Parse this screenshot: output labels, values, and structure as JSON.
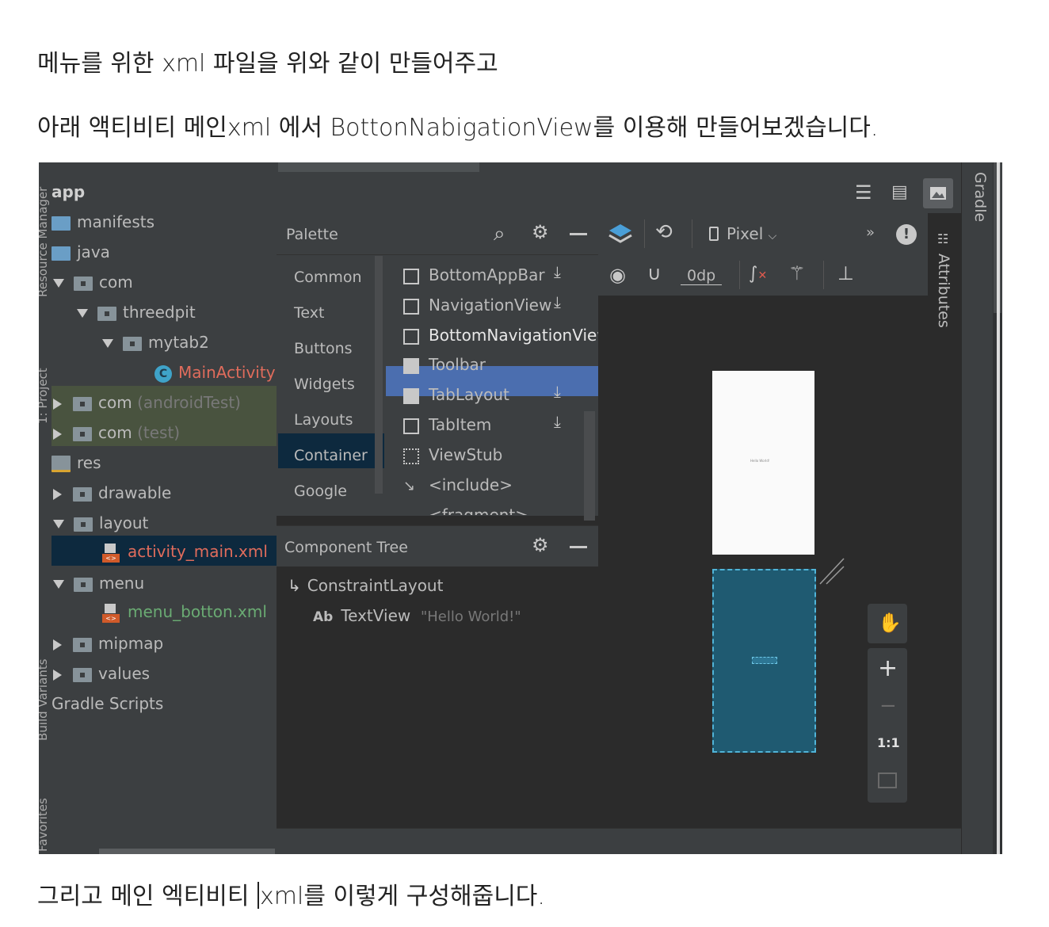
{
  "paragraphs": {
    "p1": "메뉴를 위한 xml 파일을 위와 같이 만들어주고",
    "p2": "아래 액티비티 메인xml 에서 BottonNabigationView를 이용해 만들어보겠습니다.",
    "p3_before": "그리고 메인 엑티비티 ",
    "p3_after": "xml를  이렇게 구성해줍니다."
  },
  "side_strips": {
    "resource_manager": "Resource Manager",
    "project": "1: Project",
    "build_variants": "Build Variants",
    "favorites": "Favorites",
    "gradle": "Gradle",
    "attributes": "Attributes"
  },
  "project_tree": {
    "app": "app",
    "manifests": "manifests",
    "java": "java",
    "com": "com",
    "threedpit": "threedpit",
    "mytab2": "mytab2",
    "main_activity": "MainActivity",
    "com_android_test": "com",
    "android_test_suffix": "(androidTest)",
    "com_test": "com",
    "test_suffix": "(test)",
    "res": "res",
    "drawable": "drawable",
    "layout": "layout",
    "activity_main": "activity_main.xml",
    "menu": "menu",
    "menu_botton": "menu_botton.xml",
    "mipmap": "mipmap",
    "values": "values",
    "gradle_scripts": "Gradle Scripts"
  },
  "palette": {
    "title": "Palette",
    "categories": [
      "Common",
      "Text",
      "Buttons",
      "Widgets",
      "Layouts",
      "Container",
      "Google"
    ],
    "items": [
      "BottomAppBar",
      "NavigationView",
      "BottomNavigationView",
      "Toolbar",
      "TabLayout",
      "TabItem",
      "ViewStub",
      "<include>",
      "<fragment>"
    ]
  },
  "component_tree": {
    "title": "Component Tree",
    "root": "ConstraintLayout",
    "child_prefix": "Ab",
    "child": "TextView",
    "child_text": "\"Hello World!\""
  },
  "design_toolbar": {
    "device": "Pixel",
    "margin": "0dp",
    "more": "»"
  },
  "preview": {
    "hello": "Hello World!"
  },
  "zoom": {
    "plus": "+",
    "minus": "−",
    "one_to_one": "1:1"
  }
}
